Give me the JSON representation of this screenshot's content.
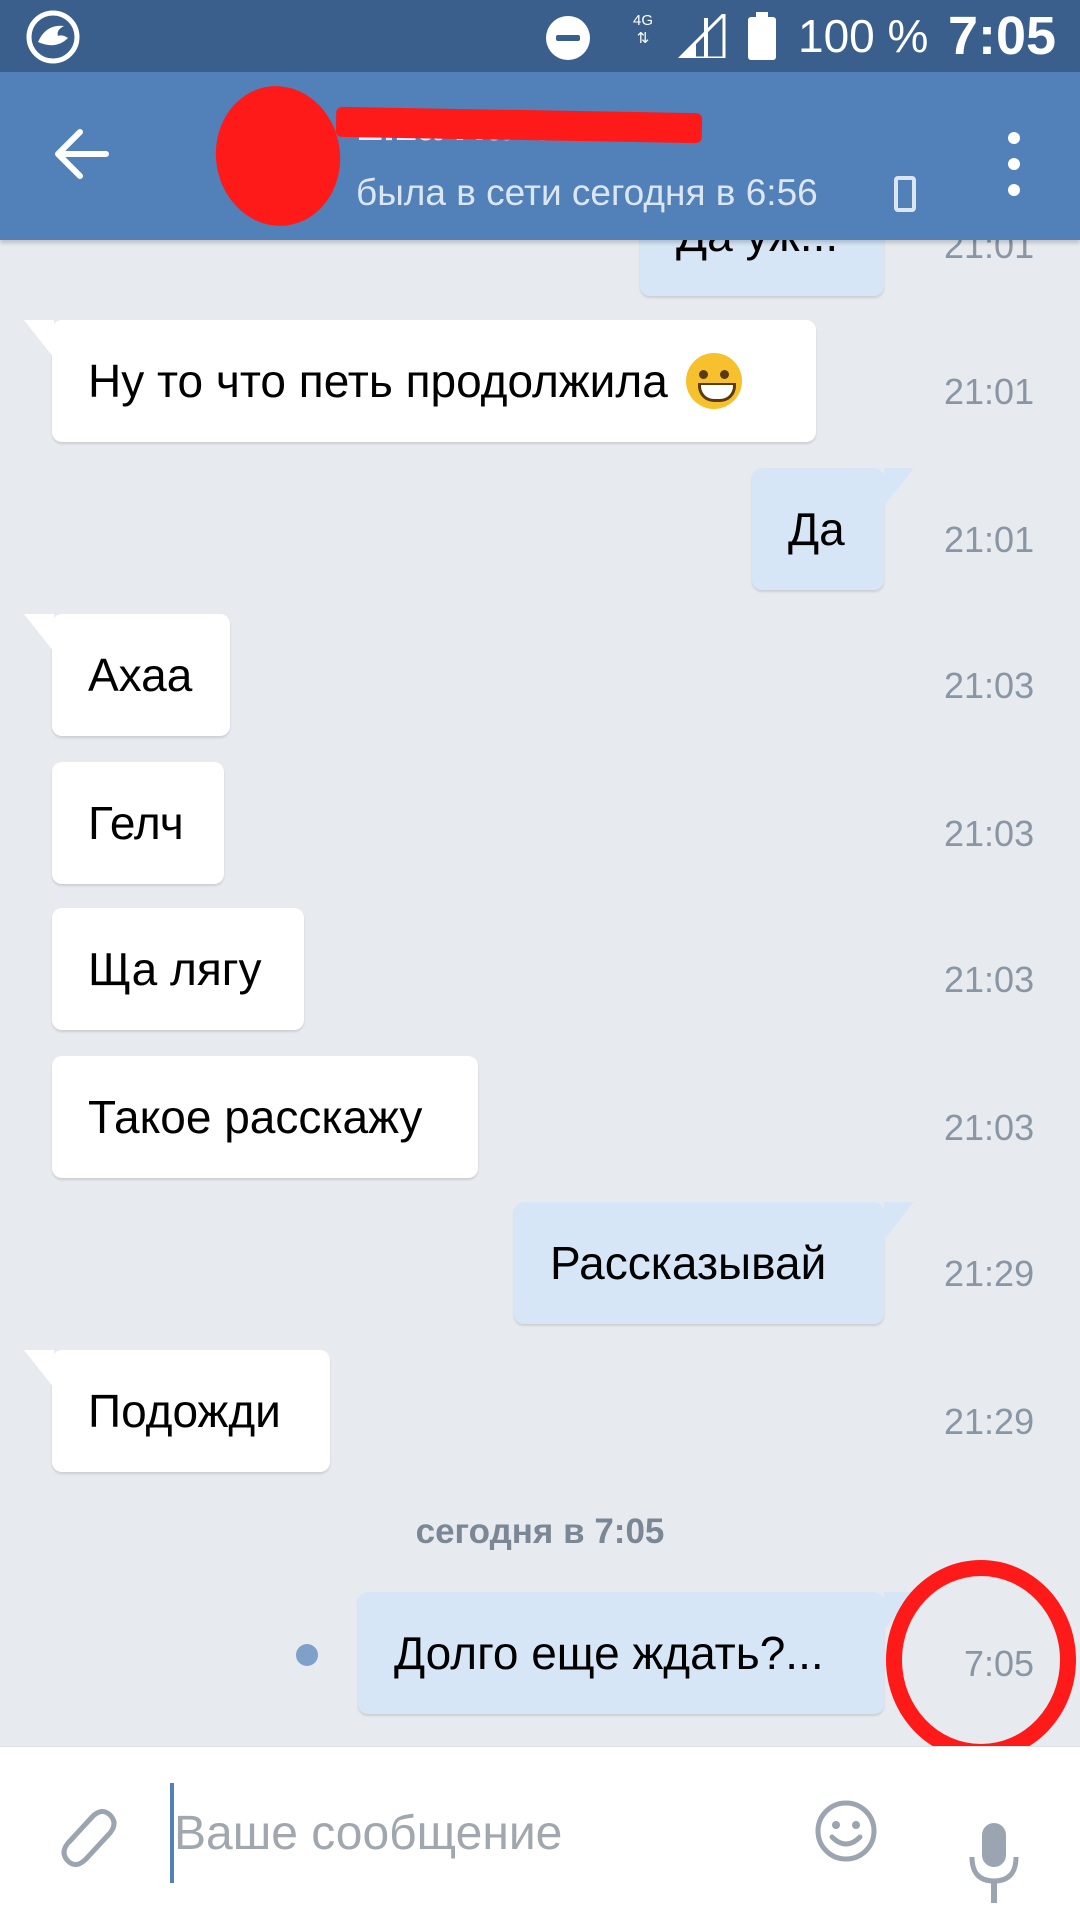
{
  "status_bar": {
    "network": "4G",
    "battery_percent": "100 %",
    "time": "7:05"
  },
  "header": {
    "contact_name": "Liza Havana",
    "last_seen": "была в сети сегодня в 6:56"
  },
  "messages": [
    {
      "dir": "out",
      "text": "Да уж...",
      "time": "21:01"
    },
    {
      "dir": "in",
      "text": "Ну то что петь продолжила",
      "time": "21:01",
      "emoji": "grinning-face"
    },
    {
      "dir": "out",
      "text": "Да",
      "time": "21:01"
    },
    {
      "dir": "in",
      "text": "Ахаа",
      "time": "21:03"
    },
    {
      "dir": "in",
      "text": "Гелч",
      "time": "21:03"
    },
    {
      "dir": "in",
      "text": "Ща лягу",
      "time": "21:03"
    },
    {
      "dir": "in",
      "text": "Такое расскажу",
      "time": "21:03"
    },
    {
      "dir": "out",
      "text": "Рассказывай",
      "time": "21:29"
    },
    {
      "dir": "in",
      "text": "Подожди",
      "time": "21:29"
    },
    {
      "dir": "out",
      "text": "Долго еще ждать?...",
      "time": "7:05",
      "unread": true
    }
  ],
  "date_separator": "сегодня в 7:05",
  "composer": {
    "placeholder": "Ваше сообщение",
    "value": ""
  },
  "colors": {
    "status_bar": "#3b5f8c",
    "header": "#5181b8",
    "background": "#e7ebf0",
    "incoming_bubble": "#ffffff",
    "outgoing_bubble": "#d7e6f6",
    "redaction": "#ff1a1a"
  },
  "icons": [
    "app-logo-icon",
    "do-not-disturb-icon",
    "signal-icon",
    "battery-icon",
    "back-arrow-icon",
    "mobile-device-icon",
    "more-vert-icon",
    "paperclip-icon",
    "smiley-icon",
    "microphone-icon"
  ]
}
